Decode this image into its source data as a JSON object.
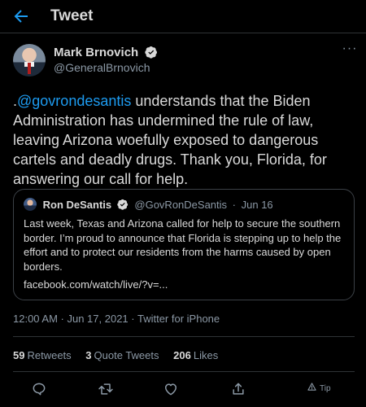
{
  "header": {
    "title": "Tweet"
  },
  "author": {
    "name": "Mark Brnovich",
    "handle": "@GeneralBrnovich"
  },
  "tweet": {
    "prefix": ".",
    "mention": "@govrondesantis",
    "body": " understands that the Biden Administration has undermined the rule of law, leaving Arizona woefully exposed to dangerous cartels and deadly drugs. Thank you, Florida, for answering our call for help."
  },
  "quote": {
    "name": "Ron DeSantis",
    "handle": "@GovRonDeSantis",
    "separator": "·",
    "date": "Jun 16",
    "text": "Last week, Texas and Arizona called for help to secure the southern border. I’m proud to announce that Florida is stepping up to help the effort and to protect our residents from the harms caused by open borders.",
    "link": "facebook.com/watch/live/?v=..."
  },
  "meta": {
    "text": "12:00 AM · Jun 17, 2021 · Twitter for iPhone"
  },
  "stats": {
    "retweets_count": "59",
    "retweets_label": "Retweets",
    "quotes_count": "3",
    "quotes_label": "Quote Tweets",
    "likes_count": "206",
    "likes_label": "Likes"
  },
  "actions": {
    "tip_label": "Tip"
  },
  "colors": {
    "accent": "#1d9bf0",
    "background": "#000000",
    "secondary_text": "#8b98a5"
  }
}
